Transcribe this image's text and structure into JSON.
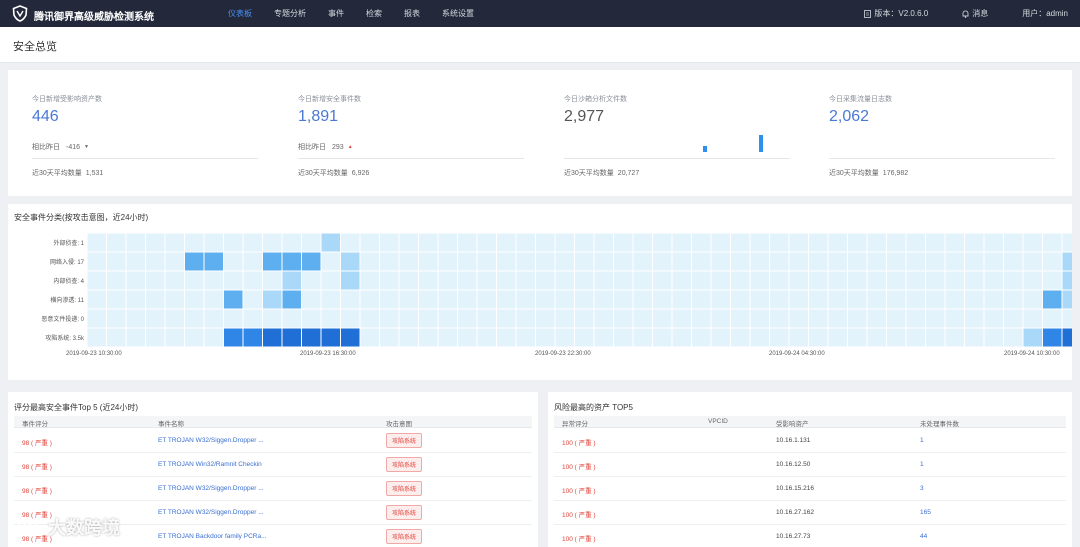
{
  "app": {
    "title": "腾讯御界高级威胁检测系统"
  },
  "nav": {
    "items": [
      "仪表板",
      "专题分析",
      "事件",
      "检索",
      "报表",
      "系统设置"
    ],
    "active_index": 0
  },
  "topright": {
    "version": "版本：V2.0.6.0",
    "messages": "消息",
    "user": "用户：admin"
  },
  "page": {
    "title": "安全总览"
  },
  "stats": [
    {
      "label": "今日新增受影响资产数",
      "value": "446",
      "compare_label": "相比昨日",
      "compare_value": "-416",
      "trend": "down",
      "avg_label": "近30天平均数量",
      "avg_value": "1,531"
    },
    {
      "label": "今日新增安全事件数",
      "value": "1,891",
      "compare_label": "相比昨日",
      "compare_value": "293",
      "trend": "up",
      "avg_label": "近30天平均数量",
      "avg_value": "6,926"
    },
    {
      "label": "今日沙箱分析文件数",
      "value": "2,977",
      "avg_label": "近30天平均数量",
      "avg_value": "20,727",
      "mini_bars": [
        0.35,
        1.0
      ]
    },
    {
      "label": "今日采集流量日志数",
      "value": "2,062",
      "avg_label": "近30天平均数量",
      "avg_value": "176,982"
    }
  ],
  "heatmap": {
    "title": "安全事件分类(按攻击意图，近24小时)",
    "rows": [
      "外部侦查: 1",
      "网络入侵: 17",
      "内部侦查: 4",
      "横向渗透: 11",
      "恶意文件投递: 0",
      "攻陷系统: 3.5k"
    ],
    "xlabels": [
      "2019-09-23 10:30:00",
      "2019-09-23 16:30:00",
      "2019-09-23 22:30:00",
      "2019-09-24 04:30:00",
      "2019-09-24 10:30:00"
    ],
    "columns": 52,
    "colors": [
      "#e3f3fc",
      "#a9d8f8",
      "#5eaff0",
      "#2f86e6",
      "#1f6fd6"
    ],
    "cells": [
      [
        0,
        12,
        1
      ],
      [
        1,
        5,
        2
      ],
      [
        1,
        6,
        2
      ],
      [
        1,
        9,
        2
      ],
      [
        1,
        10,
        2
      ],
      [
        1,
        11,
        2
      ],
      [
        1,
        13,
        1
      ],
      [
        1,
        50,
        1
      ],
      [
        1,
        51,
        2
      ],
      [
        2,
        10,
        1
      ],
      [
        2,
        13,
        1
      ],
      [
        2,
        50,
        1
      ],
      [
        3,
        7,
        2
      ],
      [
        3,
        9,
        1
      ],
      [
        3,
        10,
        2
      ],
      [
        3,
        49,
        2
      ],
      [
        3,
        50,
        1
      ],
      [
        5,
        7,
        3
      ],
      [
        5,
        8,
        3
      ],
      [
        5,
        9,
        4
      ],
      [
        5,
        10,
        4
      ],
      [
        5,
        11,
        4
      ],
      [
        5,
        12,
        4
      ],
      [
        5,
        13,
        4
      ],
      [
        5,
        48,
        1
      ],
      [
        5,
        49,
        3
      ],
      [
        5,
        50,
        4
      ],
      [
        5,
        51,
        3
      ]
    ]
  },
  "top_events": {
    "title": "评分最高安全事件Top 5 (近24小时)",
    "headers": [
      "事件评分",
      "事件名称",
      "攻击意图"
    ],
    "rows": [
      {
        "score": "98 ( 严重 )",
        "name": "ET TROJAN W32/Siggen.Dropper ...",
        "intent": "攻陷系统"
      },
      {
        "score": "98 ( 严重 )",
        "name": "ET TROJAN Win32/Ramnit Checkin",
        "intent": "攻陷系统"
      },
      {
        "score": "98 ( 严重 )",
        "name": "ET TROJAN W32/Siggen.Dropper ...",
        "intent": "攻陷系统"
      },
      {
        "score": "98 ( 严重 )",
        "name": "ET TROJAN W32/Siggen.Dropper ...",
        "intent": "攻陷系统"
      },
      {
        "score": "98 ( 严重 )",
        "name": "ET TROJAN Backdoor family PCRa...",
        "intent": "攻陷系统"
      }
    ]
  },
  "top_assets": {
    "title": "风险最高的资产 TOP5",
    "headers": [
      "异常评分",
      "VPCID",
      "受影响资产",
      "未处理事件数"
    ],
    "rows": [
      {
        "score": "100 ( 严重 )",
        "vpcid": "",
        "asset": "10.16.1.131",
        "count": "1"
      },
      {
        "score": "100 ( 严重 )",
        "vpcid": "",
        "asset": "10.16.12.50",
        "count": "1"
      },
      {
        "score": "100 ( 严重 )",
        "vpcid": "",
        "asset": "10.16.15.216",
        "count": "3"
      },
      {
        "score": "100 ( 严重 )",
        "vpcid": "",
        "asset": "10.16.27.162",
        "count": "165"
      },
      {
        "score": "100 ( 严重 )",
        "vpcid": "",
        "asset": "10.16.27.73",
        "count": "44"
      }
    ]
  },
  "watermark": {
    "text": "大数跨境"
  }
}
